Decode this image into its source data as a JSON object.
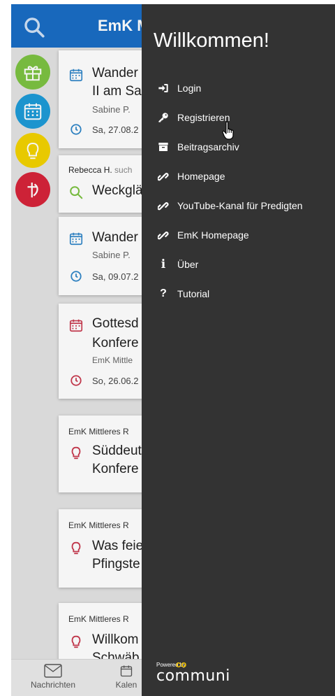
{
  "app": {
    "title": "EmK M",
    "cards": [
      {
        "title1": "Wander",
        "title2": "II am Sa",
        "sub": "Sabine P.",
        "date": "Sa, 27.08.2"
      },
      {
        "author": "Rebecca H.",
        "author_suffix": " such",
        "title1": "Weckglä"
      },
      {
        "title1": "Wander",
        "sub": "Sabine P.",
        "date": "Sa, 09.07.2"
      },
      {
        "title1": "Gottesd",
        "title2": "Konfere",
        "sub": "EmK Mittle",
        "date": "So, 26.06.2"
      },
      {
        "author": "EmK Mittleres R",
        "title1": "Süddeut",
        "title2": "Konfere"
      },
      {
        "author": "EmK Mittleres R",
        "title1": "Was feie",
        "title2": "Pfingste"
      },
      {
        "author": "EmK Mittleres R",
        "title1": "Willkom",
        "title2": "Schwäb"
      }
    ],
    "bottom_nav": [
      "Nachrichten",
      "Kalen"
    ]
  },
  "drawer": {
    "heading": "Willkommen!",
    "items": [
      {
        "label": "Login",
        "icon": "login-icon"
      },
      {
        "label": "Registrieren",
        "icon": "key-icon"
      },
      {
        "label": "Beitragsarchiv",
        "icon": "archive-icon"
      },
      {
        "label": "Homepage",
        "icon": "link-icon"
      },
      {
        "label": "YouTube-Kanal für Predigten",
        "icon": "link-icon"
      },
      {
        "label": "EmK Homepage",
        "icon": "link-icon"
      },
      {
        "label": "Über",
        "icon": "info-icon"
      },
      {
        "label": "Tutorial",
        "icon": "question-icon"
      }
    ],
    "powered_by": "Powered by",
    "brand": "communi",
    "brand_co": "co"
  },
  "colors": {
    "appbar": "#1a6dc4",
    "drawer": "#333333",
    "circle_green": "#7cc242",
    "circle_blue": "#1e9bd7",
    "circle_yellow": "#f2d200",
    "circle_red": "#d6243a",
    "card_icon_blue": "#2f86c8",
    "card_icon_red": "#c83a4f",
    "card_icon_green": "#7cc242"
  }
}
